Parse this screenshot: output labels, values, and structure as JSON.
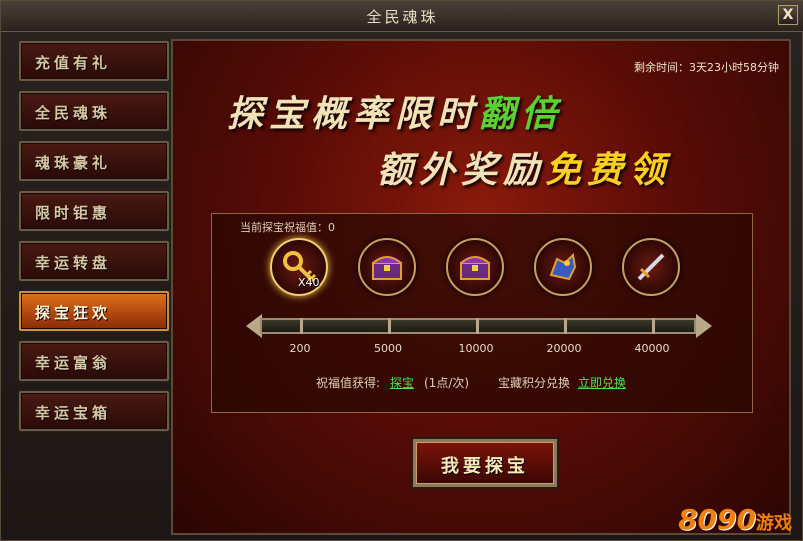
{
  "window": {
    "title": "全民魂珠",
    "close_label": "X"
  },
  "sidebar": {
    "items": [
      {
        "label": "充值有礼"
      },
      {
        "label": "全民魂珠"
      },
      {
        "label": "魂珠豪礼"
      },
      {
        "label": "限时钜惠"
      },
      {
        "label": "幸运转盘"
      },
      {
        "label": "探宝狂欢"
      },
      {
        "label": "幸运富翁"
      },
      {
        "label": "幸运宝箱"
      }
    ],
    "active_index": 5
  },
  "main": {
    "remaining": "剩余时间：3天23小时58分钟",
    "banner_line1": {
      "text": "探宝概率限时",
      "highlight": "翻倍"
    },
    "banner_line2": {
      "text": "额外奖励",
      "highlight": "免费领"
    },
    "blessing_value": "当前探宝祝福值：0",
    "items": [
      {
        "icon": "key-icon",
        "qty": "X40"
      },
      {
        "icon": "treasure-chest-icon"
      },
      {
        "icon": "treasure-chest-icon"
      },
      {
        "icon": "mount-icon"
      },
      {
        "icon": "sword-icon"
      }
    ],
    "thresholds": [
      "200",
      "5000",
      "10000",
      "20000",
      "40000"
    ],
    "progress": 0,
    "gain_label": "祝福值获得:",
    "gain_link": "探宝",
    "gain_rate": "(1点/次)",
    "exchange_label": "宝藏积分兑换",
    "exchange_link": "立即兑换",
    "draw_button": "我要探宝"
  },
  "logo": {
    "number": "8090",
    "text": "游戏"
  },
  "colors": {
    "accent_green": "#4ee04e",
    "highlight_yellow": "#ffd020",
    "active_tab": "#e07018"
  }
}
